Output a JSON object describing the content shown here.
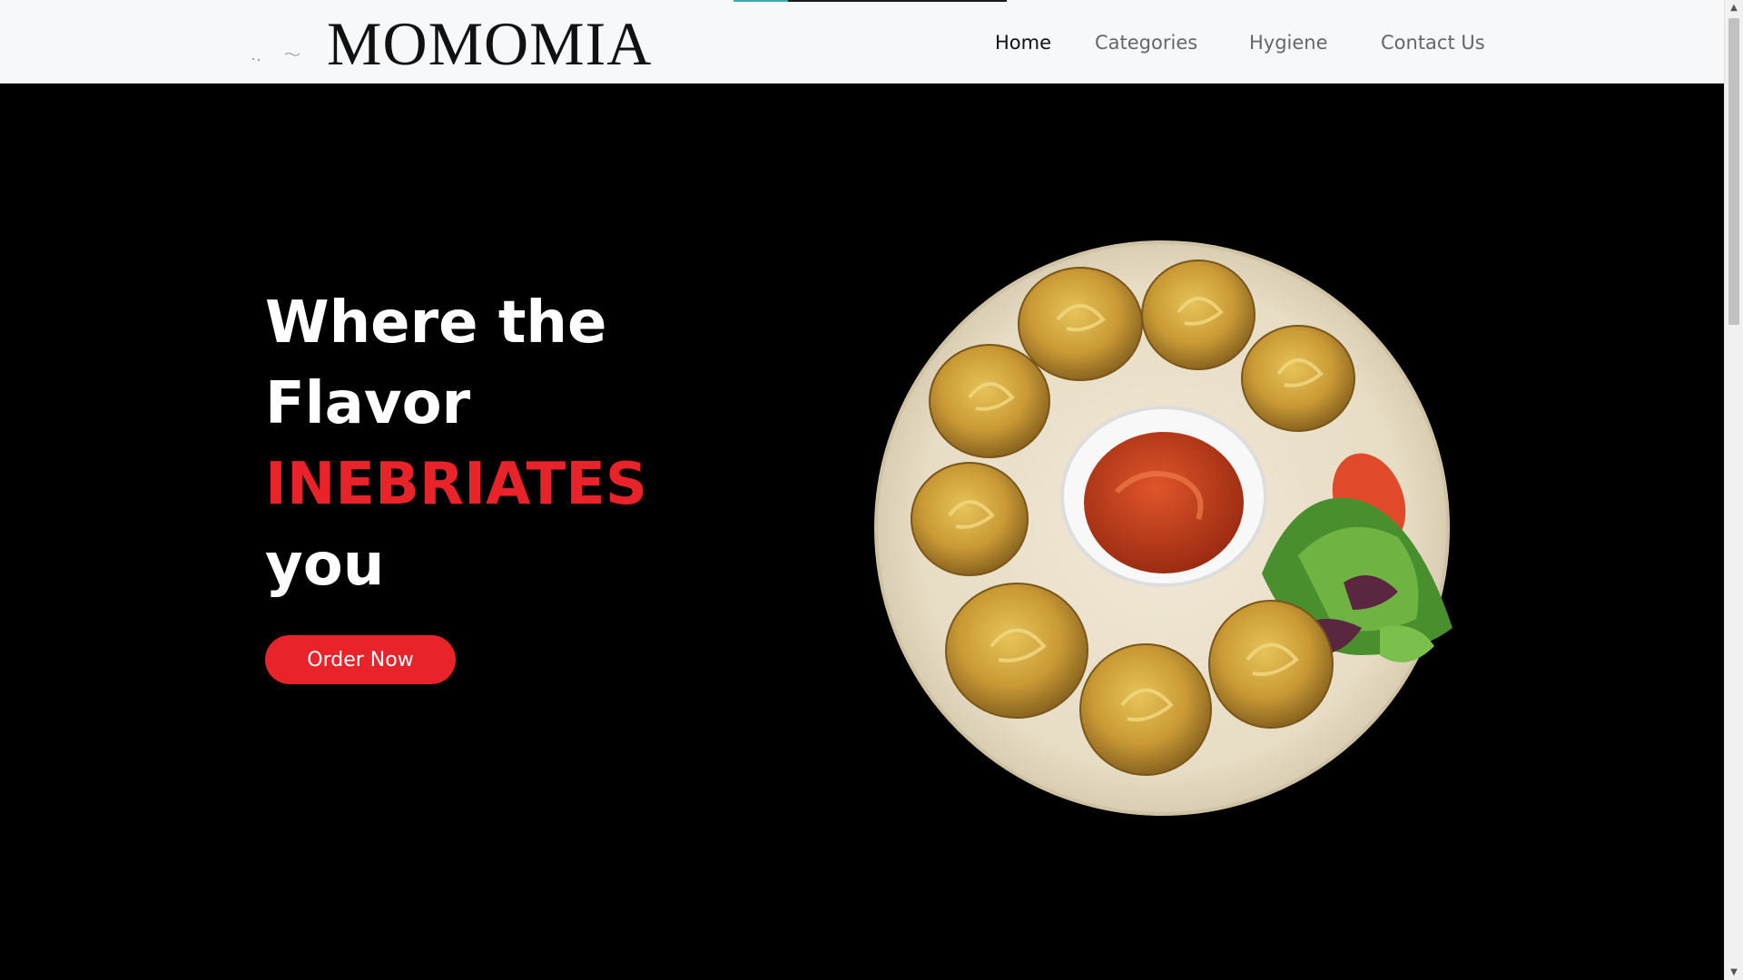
{
  "navbar": {
    "brand": "MOMOMIA",
    "links": [
      {
        "label": "Home",
        "active": true
      },
      {
        "label": "Categories",
        "active": false
      },
      {
        "label": "Hygiene",
        "active": false
      },
      {
        "label": "Contact Us",
        "active": false
      }
    ]
  },
  "hero": {
    "headline": {
      "line1": "Where the",
      "line2": "Flavor",
      "line3": "INEBRIATES",
      "line4": "you"
    },
    "order_button": "Order Now",
    "image": "momo-plate-with-sauce-and-salad"
  },
  "colors": {
    "accent": "#e8232a",
    "hero_background": "#000000",
    "navbar_background": "#f7f8fa",
    "progress_accent": "#3aa9b8"
  },
  "icons": {
    "scroll_up": "▲",
    "scroll_down": "▼"
  }
}
